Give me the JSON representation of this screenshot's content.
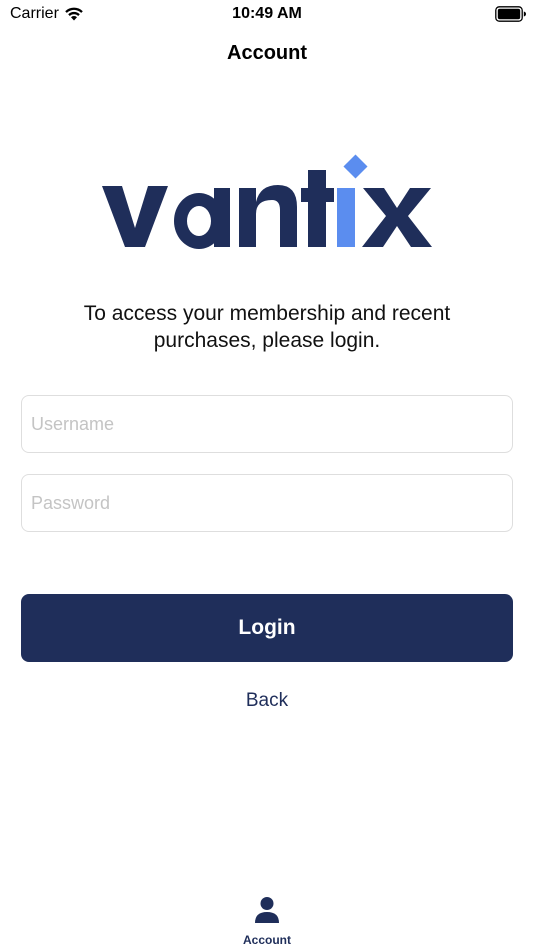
{
  "status_bar": {
    "carrier": "Carrier",
    "time": "10:49 AM"
  },
  "nav": {
    "title": "Account"
  },
  "logo": {
    "brand": "vantix",
    "primary_color": "#1f2e5a",
    "accent_color": "#5b8def"
  },
  "login": {
    "prompt": "To access your membership and recent purchases, please login.",
    "username_placeholder": "Username",
    "password_placeholder": "Password",
    "login_label": "Login",
    "back_label": "Back"
  },
  "tab_bar": {
    "items": [
      {
        "label": "Account",
        "icon": "person-icon"
      }
    ]
  }
}
